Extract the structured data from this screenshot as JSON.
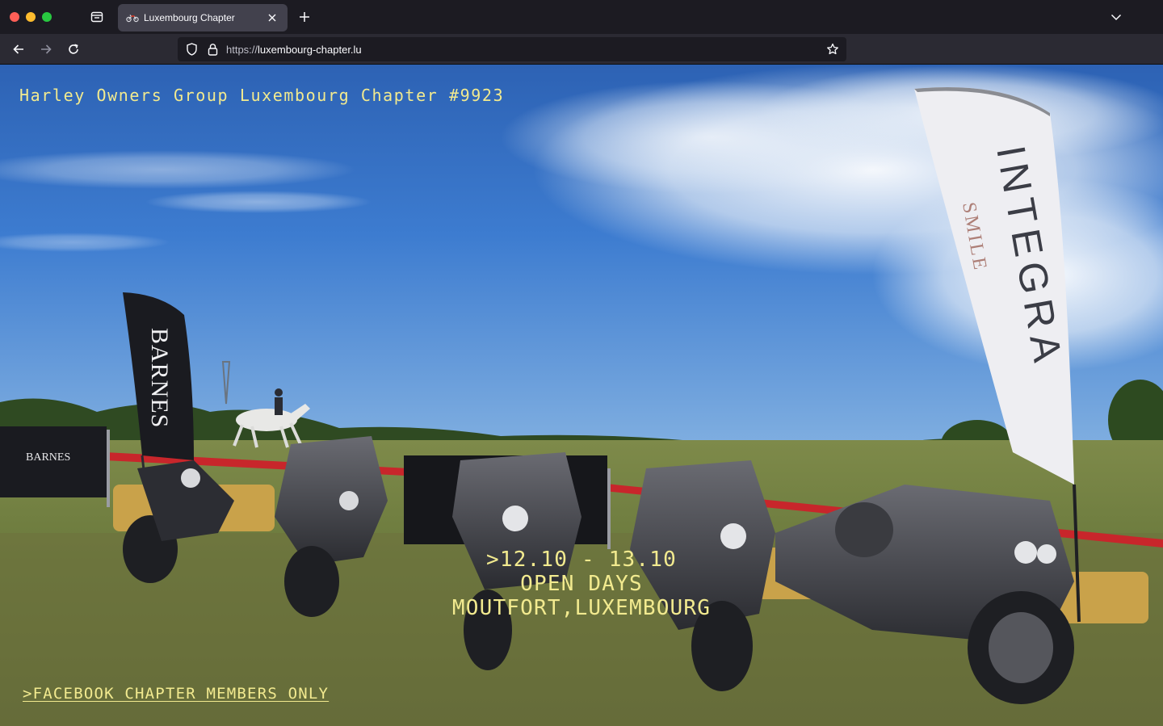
{
  "browser": {
    "tab": {
      "title": "Luxembourg Chapter"
    },
    "url": {
      "protocol": "https://",
      "host": "luxembourg-chapter.lu"
    }
  },
  "page": {
    "site_title": "Harley Owners Group Luxembourg Chapter #9923",
    "event": {
      "dates": ">12.10 - 13.10",
      "name": "OPEN DAYS",
      "location": "MOUTFORT,LUXEMBOURG"
    },
    "facebook_link": ">FACEBOOK CHAPTER MEMBERS ONLY",
    "hero_image": {
      "banner_left_text": "BARNES",
      "banner_right_text": "INTEGRA",
      "banner_right_subtext": "SMILE",
      "fence_banner_text": "BARNES"
    }
  },
  "colors": {
    "accent_text": "#f2ea8f",
    "chrome_bg": "#1c1b22",
    "navbar_bg": "#2b2a33",
    "tab_bg": "#42414d"
  }
}
